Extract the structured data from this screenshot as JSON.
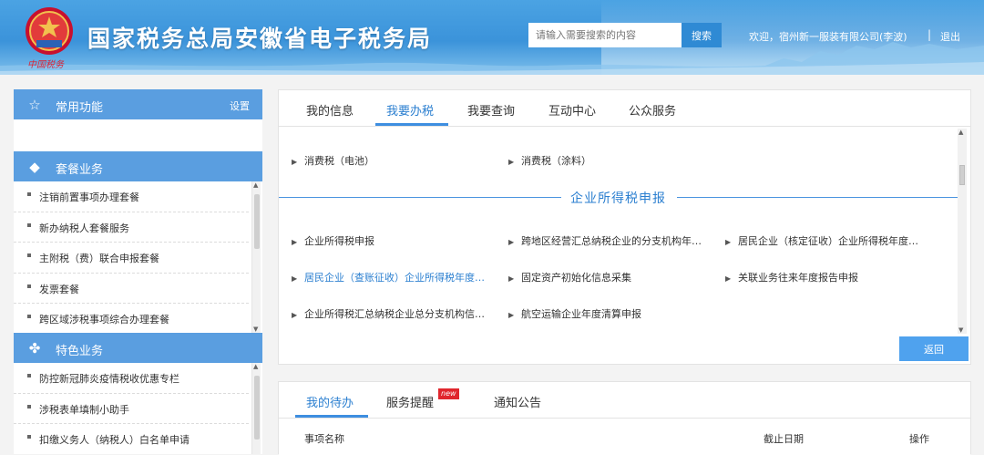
{
  "header": {
    "emblem_caption": "中国税务",
    "title": "国家税务总局安徽省电子税务局",
    "search_placeholder": "请输入需要搜索的内容",
    "search_button": "搜索",
    "welcome": "欢迎，宿州新一服装有限公司(李波)",
    "separator": "|",
    "logout": "退出"
  },
  "sidebar": {
    "common": {
      "label": "常用功能",
      "settings": "设置"
    },
    "package": {
      "label": "套餐业务",
      "items": [
        "注销前置事项办理套餐",
        "新办纳税人套餐服务",
        "主附税（费）联合申报套餐",
        "发票套餐",
        "跨区域涉税事项综合办理套餐"
      ]
    },
    "special": {
      "label": "特色业务",
      "items": [
        "防控新冠肺炎疫情税收优惠专栏",
        "涉税表单填制小助手",
        "扣缴义务人（纳税人）白名单申请"
      ]
    }
  },
  "main": {
    "tabs": [
      "我的信息",
      "我要办税",
      "我要查询",
      "互动中心",
      "公众服务"
    ],
    "active_tab": "我要办税",
    "consumption_tax": [
      "消费税（电池）",
      "消费税（涂料）"
    ],
    "section_title": "企业所得税申报",
    "cit_items": [
      "企业所得税申报",
      "跨地区经营汇总纳税企业的分支机构年…",
      "居民企业（核定征收）企业所得税年度…",
      "居民企业（查账征收）企业所得税年度…",
      "固定资产初始化信息采集",
      "关联业务往来年度报告申报",
      "企业所得税汇总纳税企业总分支机构信…",
      "航空运输企业年度清算申报"
    ],
    "back_button": "返回"
  },
  "todo": {
    "tabs": [
      "我的待办",
      "服务提醒",
      "通知公告"
    ],
    "new_badge": "new",
    "columns": [
      "事项名称",
      "截止日期",
      "操作"
    ]
  },
  "colors": {
    "accent": "#2b7fd0",
    "sidebar_header": "#5a9ee0",
    "button": "#4fa2ee",
    "badge": "#e0262d"
  }
}
